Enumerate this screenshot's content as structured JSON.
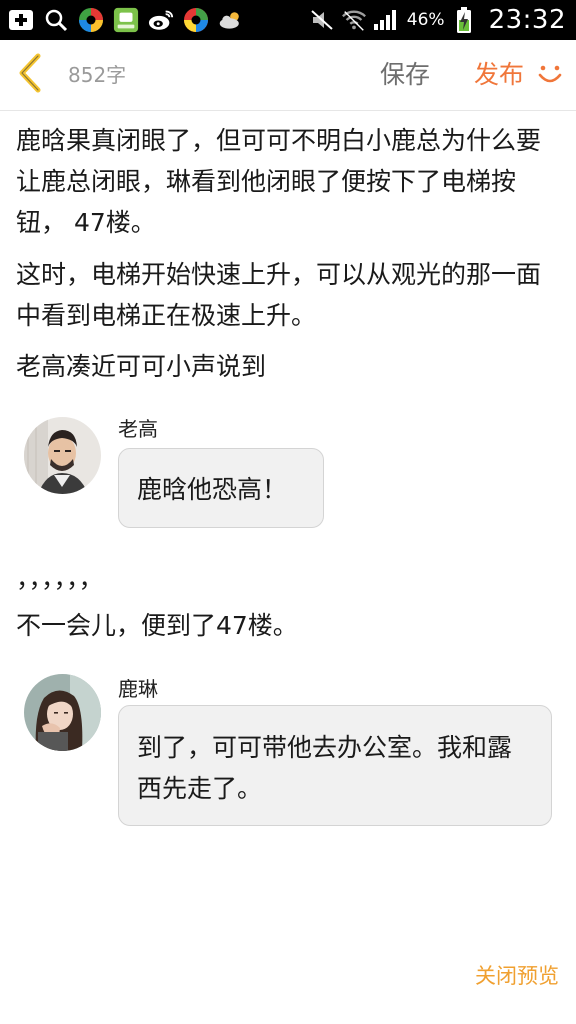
{
  "status_bar": {
    "battery_percent": "46%",
    "time": "23:32",
    "icons": [
      "add-box-icon",
      "search-icon",
      "app-green-icon",
      "app-pad-icon",
      "weibo-icon",
      "app-colorful-icon",
      "cloud-weather-icon",
      "mute-icon",
      "wifi-icon",
      "signal-icon",
      "battery-charging-icon"
    ]
  },
  "topbar": {
    "word_count": "852字",
    "save_label": "保存",
    "publish_label": "发布",
    "accent_color": "#f0763a"
  },
  "content": {
    "paragraphs": [
      "鹿晗果真闭眼了，但可可不明白小鹿总为什么要让鹿总闭眼，琳看到他闭眼了便按下了电梯按钮， 47楼。",
      "这时，电梯开始快速上升，可以从观光的那一面中看到电梯正在极速上升。",
      "老高凑近可可小声说到",
      "，，，，，，",
      "不一会儿，便到了47楼。"
    ],
    "messages": [
      {
        "speaker": "老高",
        "text": "鹿晗他恐高！"
      },
      {
        "speaker": "鹿琳",
        "text": "到了，可可带他去办公室。我和露西先走了。"
      }
    ]
  },
  "footer": {
    "close_preview_label": "关闭预览",
    "color": "#f0a030"
  }
}
